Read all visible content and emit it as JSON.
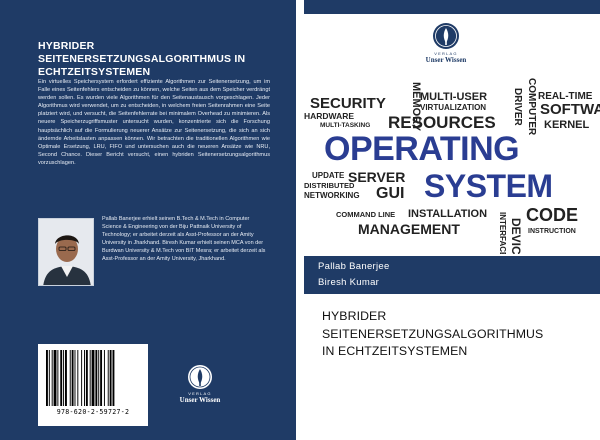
{
  "back_cover": {
    "title_line1": "HYBRIDER",
    "title_line2": "SEITENERSETZUNGSALGORITHMUS IN",
    "title_line3": "ECHTZEITSYSTEMEN",
    "blurb": "Ein virtuelles Speichersystem erfordert effiziente Algorithmen zur Seitenersetzung, um im Falle eines Seitenfehlers entscheiden zu können, welche Seiten aus dem Speicher verdrängt werden sollen. Es wurden viele Algorithmen für den Seitenaustausch vorgeschlagen. Jeder Algorithmus wird verwendet, um zu entscheiden, in welchem freien Seitenrahmen eine Seite platziert wird, und versucht, die Seitenfehlerrate bei minimalem Overhead zu minimieren. Als neuere Speicherzugriffsmuster untersucht wurden, konzentrierte sich die Forschung hauptsächlich auf die Formulierung neuerer Ansätze zur Seitenersetzung, die sich an sich ändernde Arbeitslasten anpassen können. Wir betrachten die traditionellen Algorithmen wie Optimale Ersetzung, LRU, FIFO und untersuchen auch die neueren Ansätze wie NRU, Second Chance. Dieser Bericht versucht, einen hybriden Seitenersetzungsalgorithmus vorzuschlagen.",
    "author_bio": "Pallab Banerjee erhielt seinen B.Tech & M.Tech in Computer Science & Engineering von der Biju Pattnaik University of Technology; er arbeitet derzeit als Asst-Professor an der Amity University in Jharkhand. Biresh Kumar erhielt seinen MCA von der Burdwan University & M.Tech von BIT Mesra; er arbeitet derzeit als Asst-Professor an der Amity University, Jharkhand.",
    "isbn": "978-620-2-59727-2"
  },
  "publisher": {
    "verlag": "VERLAG",
    "name": "Unser Wissen"
  },
  "front_cover": {
    "wordcloud": [
      "SECURITY",
      "MEMORY",
      "MULTI-USER",
      "REAL-TIME",
      "HARDWARE",
      "VIRTUALIZATION",
      "SOFTWARE",
      "MULTI-TASKING",
      "RESOURCES",
      "DRIVER",
      "COMPUTER",
      "KERNEL",
      "OPERATING",
      "SYSTEM",
      "UPDATE",
      "SERVER",
      "DISTRIBUTED",
      "NETWORKING",
      "GUI",
      "COMMAND LINE",
      "INSTALLATION",
      "CODE",
      "MANAGEMENT",
      "INTERFACE",
      "DEVICE",
      "INSTRUCTION"
    ],
    "author1": "Pallab Banerjee",
    "author2": "Biresh Kumar",
    "title_line1": "HYBRIDER",
    "title_line2": "SEITENERSETZUNGSALGORITHMUS",
    "title_line3": "IN ECHTZEITSYSTEMEN"
  },
  "colors": {
    "navy": "#1f3b66",
    "cloud_blue": "#2a3d92"
  },
  "icons": [
    "publisher-logo-icon",
    "author-photo",
    "barcode"
  ]
}
